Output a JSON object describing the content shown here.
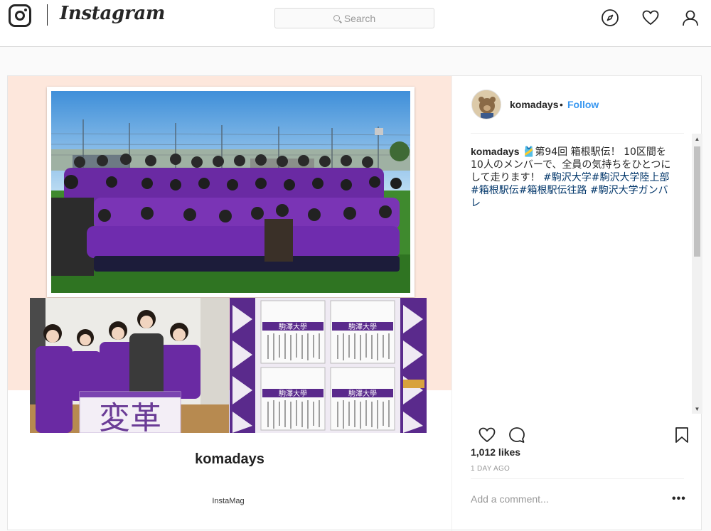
{
  "nav": {
    "logo_icon": "instagram-camera-icon",
    "wordmark": "Instagram",
    "search_placeholder": "Search",
    "icons": [
      "compass-explore-icon",
      "heart-activity-icon",
      "user-profile-icon"
    ]
  },
  "post": {
    "media": {
      "collage_title": "komadays",
      "collage_credit": "InstaMag",
      "banner_text": "変革",
      "board_header": "駒澤大學",
      "colors": {
        "peach": "#fde7dc",
        "team_purple": "#6a2aa3"
      }
    },
    "header": {
      "username": "komadays",
      "separator": "•",
      "follow_label": "Follow"
    },
    "caption": {
      "username": "komadays",
      "text": "🎽第94回 箱根駅伝！ 10区間を10人のメンバーで、全員の気持ちをひとつにして走ります！",
      "hashtags": "#駒沢大学#駒沢大学陸上部 #箱根駅伝#箱根駅伝往路 #駒沢大学ガンバレ"
    },
    "actions": {
      "icons": [
        "heart-like-icon",
        "comment-bubble-icon",
        "bookmark-icon"
      ],
      "likes": "1,012 likes",
      "timestamp": "1 DAY AGO",
      "comment_placeholder": "Add a comment...",
      "more_label": "•••"
    },
    "colors": {
      "link_blue": "#3897f0",
      "hashtag_blue": "#003569"
    }
  }
}
